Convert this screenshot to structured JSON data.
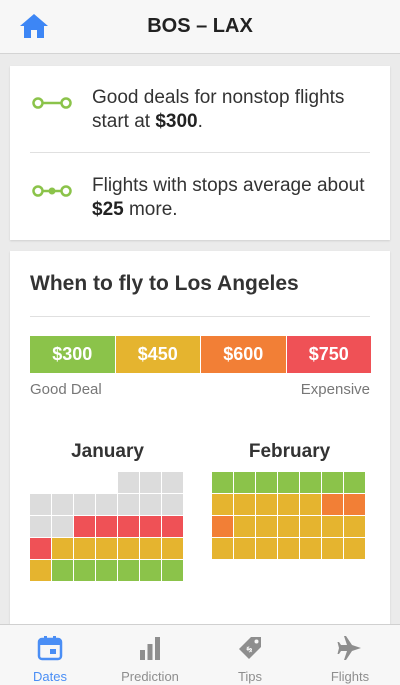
{
  "header": {
    "title": "BOS – LAX",
    "home_icon": "home-icon"
  },
  "deals": {
    "nonstop_text": "Good deals for nonstop flights start at ",
    "nonstop_price": "$300",
    "nonstop_suffix": ".",
    "stops_text": "Flights with stops average about ",
    "stops_price": "$25",
    "stops_suffix": " more."
  },
  "when": {
    "title": "When to fly to Los Angeles",
    "legend": [
      {
        "label": "$300",
        "color": "#8bc34a"
      },
      {
        "label": "$450",
        "color": "#e5b42f"
      },
      {
        "label": "$600",
        "color": "#f27f36"
      },
      {
        "label": "$750",
        "color": "#ef5156"
      }
    ],
    "good_label": "Good Deal",
    "expensive_label": "Expensive"
  },
  "calendars": [
    {
      "month": "January",
      "rows": [
        [
          "x",
          "x",
          "x",
          "x",
          "e",
          "e",
          "e"
        ],
        [
          "e",
          "e",
          "e",
          "e",
          "e",
          "e",
          "e"
        ],
        [
          "e",
          "e",
          "r",
          "r",
          "r",
          "r",
          "r"
        ],
        [
          "r",
          "y",
          "y",
          "y",
          "y",
          "y",
          "y"
        ],
        [
          "y",
          "g",
          "g",
          "g",
          "g",
          "g",
          "g"
        ]
      ]
    },
    {
      "month": "February",
      "rows": [
        [
          "g",
          "g",
          "g",
          "g",
          "g",
          "g",
          "g"
        ],
        [
          "y",
          "y",
          "y",
          "y",
          "y",
          "o",
          "o"
        ],
        [
          "o",
          "y",
          "y",
          "y",
          "y",
          "y",
          "y"
        ],
        [
          "y",
          "y",
          "y",
          "y",
          "y",
          "y",
          "y"
        ]
      ]
    }
  ],
  "colors": {
    "g": "#8bc34a",
    "y": "#e5b42f",
    "o": "#f27f36",
    "r": "#ef5156",
    "e": "#dcdcdc",
    "x": "transparent",
    "accent": "#4a8ef5",
    "inactive": "#8e8e8e"
  },
  "tabs": [
    {
      "label": "Dates",
      "icon": "calendar-icon",
      "active": true
    },
    {
      "label": "Prediction",
      "icon": "bar-chart-icon",
      "active": false
    },
    {
      "label": "Tips",
      "icon": "price-tag-icon",
      "active": false
    },
    {
      "label": "Flights",
      "icon": "airplane-icon",
      "active": false
    }
  ]
}
